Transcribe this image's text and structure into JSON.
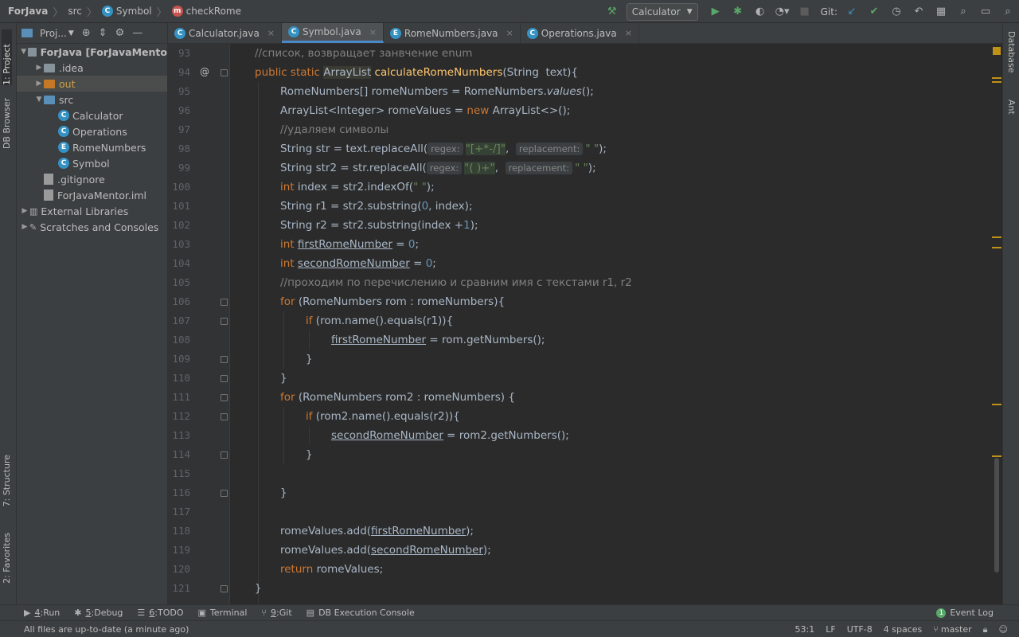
{
  "breadcrumbs": [
    {
      "label": "ForJava",
      "icon": "none"
    },
    {
      "label": "src",
      "icon": "none"
    },
    {
      "label": "Symbol",
      "icon": "class-icon"
    },
    {
      "label": "checkRome",
      "icon": "method-icon"
    }
  ],
  "toolbar": {
    "run_config": "Calculator",
    "git_label": "Git:"
  },
  "left_tabs": {
    "project": "1: Project",
    "db_browser": "DB Browser",
    "structure": "7: Structure",
    "favorites": "2: Favorites"
  },
  "right_tabs": {
    "database": "Database",
    "ant": "Ant"
  },
  "project_panel": {
    "title": "Proj...",
    "tree": [
      {
        "label": "ForJava [ForJavaMento",
        "indent": 0,
        "type": "folder",
        "expanded": true
      },
      {
        "label": ".idea",
        "indent": 1,
        "type": "folder",
        "expanded": false
      },
      {
        "label": "out",
        "indent": 1,
        "type": "folder-orange",
        "expanded": false
      },
      {
        "label": "src",
        "indent": 1,
        "type": "folder-blue",
        "expanded": true
      },
      {
        "label": "Calculator",
        "indent": 2,
        "type": "class"
      },
      {
        "label": "Operations",
        "indent": 2,
        "type": "class"
      },
      {
        "label": "RomeNumbers",
        "indent": 2,
        "type": "enum"
      },
      {
        "label": "Symbol",
        "indent": 2,
        "type": "class"
      },
      {
        "label": ".gitignore",
        "indent": 1,
        "type": "file"
      },
      {
        "label": "ForJavaMentor.iml",
        "indent": 1,
        "type": "file"
      },
      {
        "label": "External Libraries",
        "indent": 0,
        "type": "library",
        "expanded": false
      },
      {
        "label": "Scratches and Consoles",
        "indent": 0,
        "type": "scratch",
        "expanded": false
      }
    ]
  },
  "tabs": [
    {
      "label": "Calculator.java",
      "active": false,
      "icon": "C"
    },
    {
      "label": "Symbol.java",
      "active": true,
      "icon": "C"
    },
    {
      "label": "RomeNumbers.java",
      "active": false,
      "icon": "E"
    },
    {
      "label": "Operations.java",
      "active": false,
      "icon": "C"
    }
  ],
  "code": {
    "line_numbers": [
      "93",
      "94",
      "95",
      "96",
      "97",
      "98",
      "99",
      "100",
      "101",
      "102",
      "103",
      "104",
      "105",
      "106",
      "107",
      "108",
      "109",
      "110",
      "111",
      "112",
      "113",
      "114",
      "115",
      "116",
      "117",
      "118",
      "119",
      "120",
      "121"
    ],
    "l93": "//список, возвращает занвчение enum",
    "l94_kw": "public static",
    "l94_type": "ArrayList",
    "l94_fn": "calculateRomeNumbers",
    "l94_rest": "(String  text){",
    "l95_a": "RomeNumbers[] romeNumbers = RomeNumbers.",
    "l95_b": "values",
    "l95_c": "();",
    "l96_a": "ArrayList<Integer> romeValues = ",
    "l96_kw": "new",
    "l96_b": " ArrayList<>();",
    "l97": "//удаляем символы",
    "l98_a": "String str = text.replaceAll(",
    "l98_hint1": "regex:",
    "l98_s1": "\"[+*-/]\"",
    "l98_comma": ",",
    "l98_hint2": "replacement:",
    "l98_s2": "\" \"",
    "l98_end": ");",
    "l99_a": "String str2 = str.replaceAll(",
    "l99_hint1": "regex:",
    "l99_s1": "\"( )+\"",
    "l99_comma": ",",
    "l99_hint2": "replacement:",
    "l99_s2": "\" \"",
    "l99_end": ");",
    "l100_kw": "int",
    "l100_a": " index = str2.indexOf(",
    "l100_s": "\" \"",
    "l100_end": ");",
    "l101_a": "String r1 = str2.substring(",
    "l101_n": "0",
    "l101_b": ", index);",
    "l102_a": "String r2 = str2.substring(index +",
    "l102_n": "1",
    "l102_b": ");",
    "l103_kw": "int",
    "l103_var": "firstRomeNumber",
    "l103_eq": " = ",
    "l103_n": "0",
    "l103_end": ";",
    "l104_kw": "int",
    "l104_var": "secondRomeNumber",
    "l104_eq": " = ",
    "l104_n": "0",
    "l104_end": ";",
    "l105": "//проходим по перечислению и сравним имя с текстами r1, r2",
    "l106_kw": "for",
    "l106_a": " (RomeNumbers rom : romeNumbers){",
    "l107_kw": "if",
    "l107_a": " (rom.name().equals(r1)){",
    "l108_var": "firstRomeNumber",
    "l108_a": " = rom.getNumbers();",
    "l109": "}",
    "l110": "}",
    "l111_kw": "for",
    "l111_a": " (RomeNumbers rom2 : romeNumbers) {",
    "l112_kw": "if",
    "l112_a": " (rom2.name().equals(r2)){",
    "l113_var": "secondRomeNumber",
    "l113_a": " = rom2.getNumbers();",
    "l114": "}",
    "l116": "}",
    "l118_a": "romeValues.add(",
    "l118_var": "firstRomeNumber",
    "l118_b": ");",
    "l119_a": "romeValues.add(",
    "l119_var": "secondRomeNumber",
    "l119_b": ");",
    "l120_kw": "return",
    "l120_a": " romeValues;",
    "l121": "}"
  },
  "tool_windows": [
    {
      "num": "4",
      "label": "Run",
      "icon": "run-icon"
    },
    {
      "num": "5",
      "label": "Debug",
      "icon": "debug-icon"
    },
    {
      "num": "6",
      "label": "TODO",
      "icon": "todo-icon"
    },
    {
      "num": "",
      "label": "Terminal",
      "icon": "terminal-icon"
    },
    {
      "num": "9",
      "label": "Git",
      "icon": "git-icon"
    },
    {
      "num": "",
      "label": "DB Execution Console",
      "icon": "db-console-icon"
    }
  ],
  "event_log": {
    "badge": "1",
    "label": "Event Log"
  },
  "status": {
    "message": "All files are up-to-date (a minute ago)",
    "position": "53:1",
    "line_sep": "LF",
    "encoding": "UTF-8",
    "indent": "4 spaces",
    "branch": "master"
  },
  "colors": {
    "accent": "#4a88c7",
    "run_green": "#59a869",
    "keyword": "#cc7832",
    "string": "#6a8759",
    "number": "#6897bb",
    "function": "#ffc66d"
  }
}
